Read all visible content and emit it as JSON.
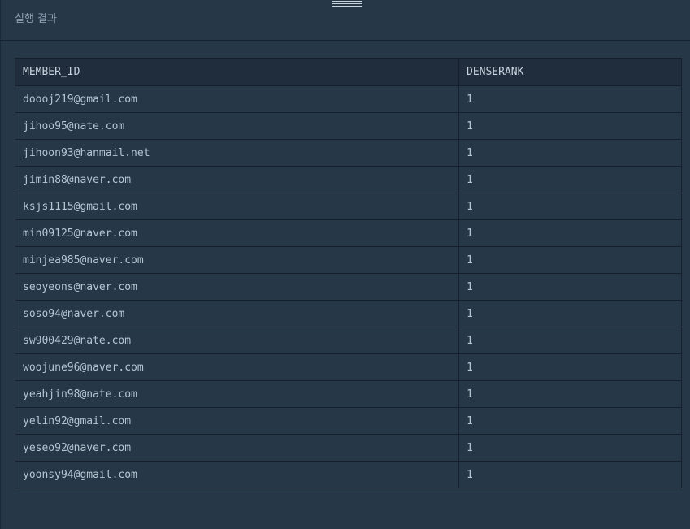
{
  "panel": {
    "title": "실행 결과"
  },
  "table": {
    "columns": [
      "MEMBER_ID",
      "DENSERANK"
    ],
    "rows": [
      [
        "doooj219@gmail.com",
        "1"
      ],
      [
        "jihoo95@nate.com",
        "1"
      ],
      [
        "jihoon93@hanmail.net",
        "1"
      ],
      [
        "jimin88@naver.com",
        "1"
      ],
      [
        "ksjs1115@gmail.com",
        "1"
      ],
      [
        "min09125@naver.com",
        "1"
      ],
      [
        "minjea985@naver.com",
        "1"
      ],
      [
        "seoyeons@naver.com",
        "1"
      ],
      [
        "soso94@naver.com",
        "1"
      ],
      [
        "sw900429@nate.com",
        "1"
      ],
      [
        "woojune96@naver.com",
        "1"
      ],
      [
        "yeahjin98@nate.com",
        "1"
      ],
      [
        "yelin92@gmail.com",
        "1"
      ],
      [
        "yeseo92@naver.com",
        "1"
      ],
      [
        "yoonsy94@gmail.com",
        "1"
      ]
    ]
  },
  "icons": {
    "drag_handle": "drag-handle-icon"
  }
}
